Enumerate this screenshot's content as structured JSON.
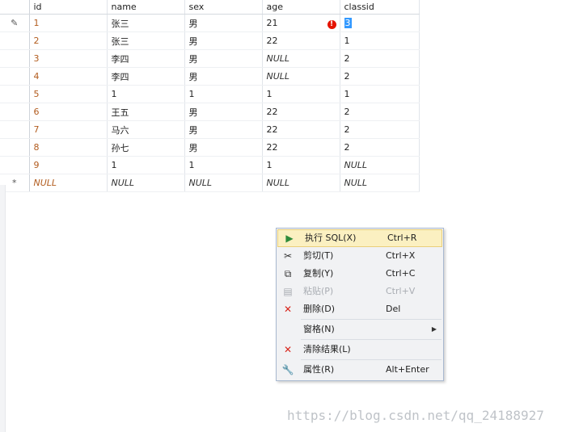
{
  "grid": {
    "columns": [
      "id",
      "name",
      "sex",
      "age",
      "classid"
    ],
    "rows": [
      {
        "marker": "✎",
        "cells": [
          "1",
          "张三",
          "男",
          "21",
          "3"
        ],
        "error": "!"
      },
      {
        "marker": "",
        "cells": [
          "2",
          "张三",
          "男",
          "22",
          "1"
        ]
      },
      {
        "marker": "",
        "cells": [
          "3",
          "李四",
          "男",
          "NULL",
          "2"
        ]
      },
      {
        "marker": "",
        "cells": [
          "4",
          "李四",
          "男",
          "NULL",
          "2"
        ]
      },
      {
        "marker": "",
        "cells": [
          "5",
          "1",
          "1",
          "1",
          "1"
        ]
      },
      {
        "marker": "",
        "cells": [
          "6",
          "王五",
          "男",
          "22",
          "2"
        ]
      },
      {
        "marker": "",
        "cells": [
          "7",
          "马六",
          "男",
          "22",
          "2"
        ]
      },
      {
        "marker": "",
        "cells": [
          "8",
          "孙七",
          "男",
          "22",
          "2"
        ]
      },
      {
        "marker": "",
        "cells": [
          "9",
          "1",
          "1",
          "1",
          "NULL"
        ]
      },
      {
        "marker": "*",
        "cells": [
          "NULL",
          "NULL",
          "NULL",
          "NULL",
          "NULL"
        ]
      }
    ]
  },
  "context_menu": {
    "items": [
      {
        "name": "execute-sql",
        "label": "执行 SQL(X)",
        "shortcut": "Ctrl+R",
        "icon": "execute-sql-icon",
        "glyph": "▶",
        "hover": true
      },
      {
        "name": "cut",
        "label": "剪切(T)",
        "shortcut": "Ctrl+X",
        "icon": "scissors-icon",
        "glyph": "✂"
      },
      {
        "name": "copy",
        "label": "复制(Y)",
        "shortcut": "Ctrl+C",
        "icon": "copy-icon",
        "glyph": "⧉"
      },
      {
        "name": "paste",
        "label": "粘贴(P)",
        "shortcut": "Ctrl+V",
        "icon": "paste-icon",
        "glyph": "▤",
        "disabled": true
      },
      {
        "name": "delete",
        "label": "删除(D)",
        "shortcut": "Del",
        "icon": "delete-x-icon",
        "glyph": "✕",
        "red": true
      },
      {
        "sep": true
      },
      {
        "name": "pane",
        "label": "窗格(N)",
        "shortcut": "",
        "icon": "",
        "glyph": "",
        "submenu": true
      },
      {
        "sep": true
      },
      {
        "name": "clear-results",
        "label": "清除结果(L)",
        "shortcut": "",
        "icon": "clear-x-icon",
        "glyph": "✕",
        "red": true
      },
      {
        "sep": true
      },
      {
        "name": "properties",
        "label": "属性(R)",
        "shortcut": "Alt+Enter",
        "icon": "wrench-icon",
        "glyph": "🔧"
      }
    ]
  },
  "watermark": "https://blog.csdn.net/qq_24188927"
}
